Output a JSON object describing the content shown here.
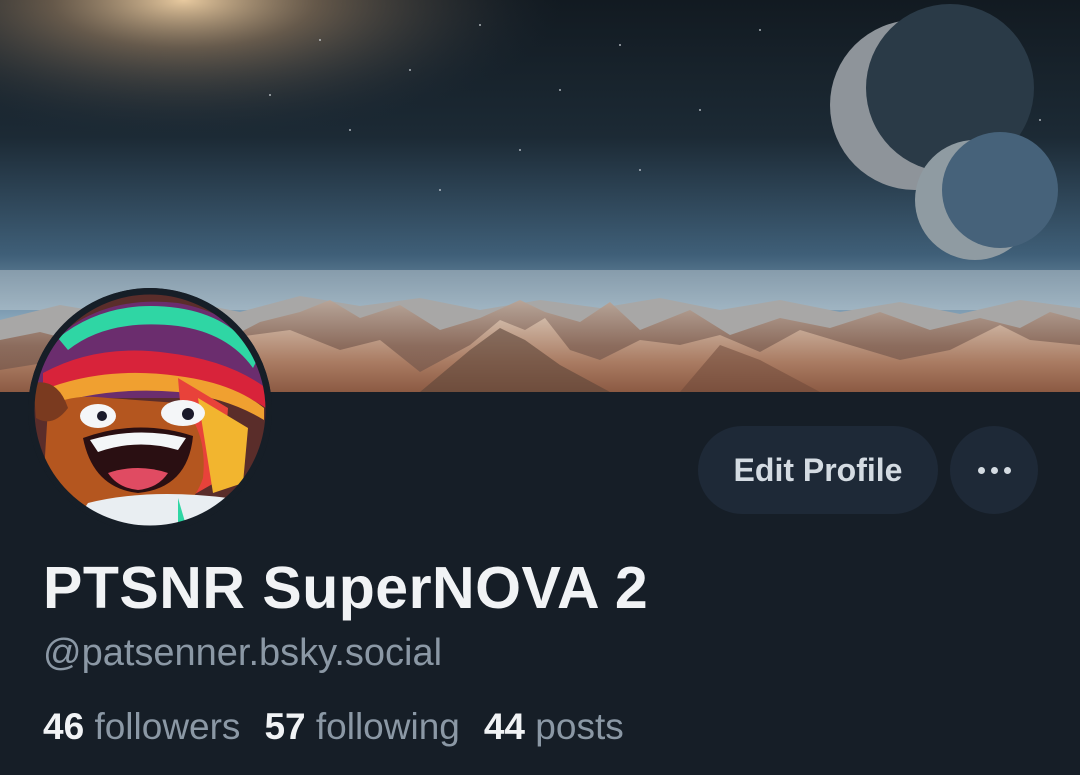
{
  "profile": {
    "display_name": "PTSNR SuperNOVA 2",
    "handle": "@patsenner.bsky.social",
    "banner_icon": "planet-landscape-banner",
    "avatar_icon": "cartoon-character-avatar"
  },
  "actions": {
    "edit_profile_label": "Edit Profile",
    "more_icon": "ellipsis-icon"
  },
  "stats": {
    "followers": {
      "count": "46",
      "label": "followers"
    },
    "following": {
      "count": "57",
      "label": "following"
    },
    "posts": {
      "count": "44",
      "label": "posts"
    }
  },
  "colors": {
    "background": "#161e27",
    "button_bg": "#1e2937",
    "text_primary": "#f1f3f5",
    "text_secondary": "#8b98a5"
  }
}
